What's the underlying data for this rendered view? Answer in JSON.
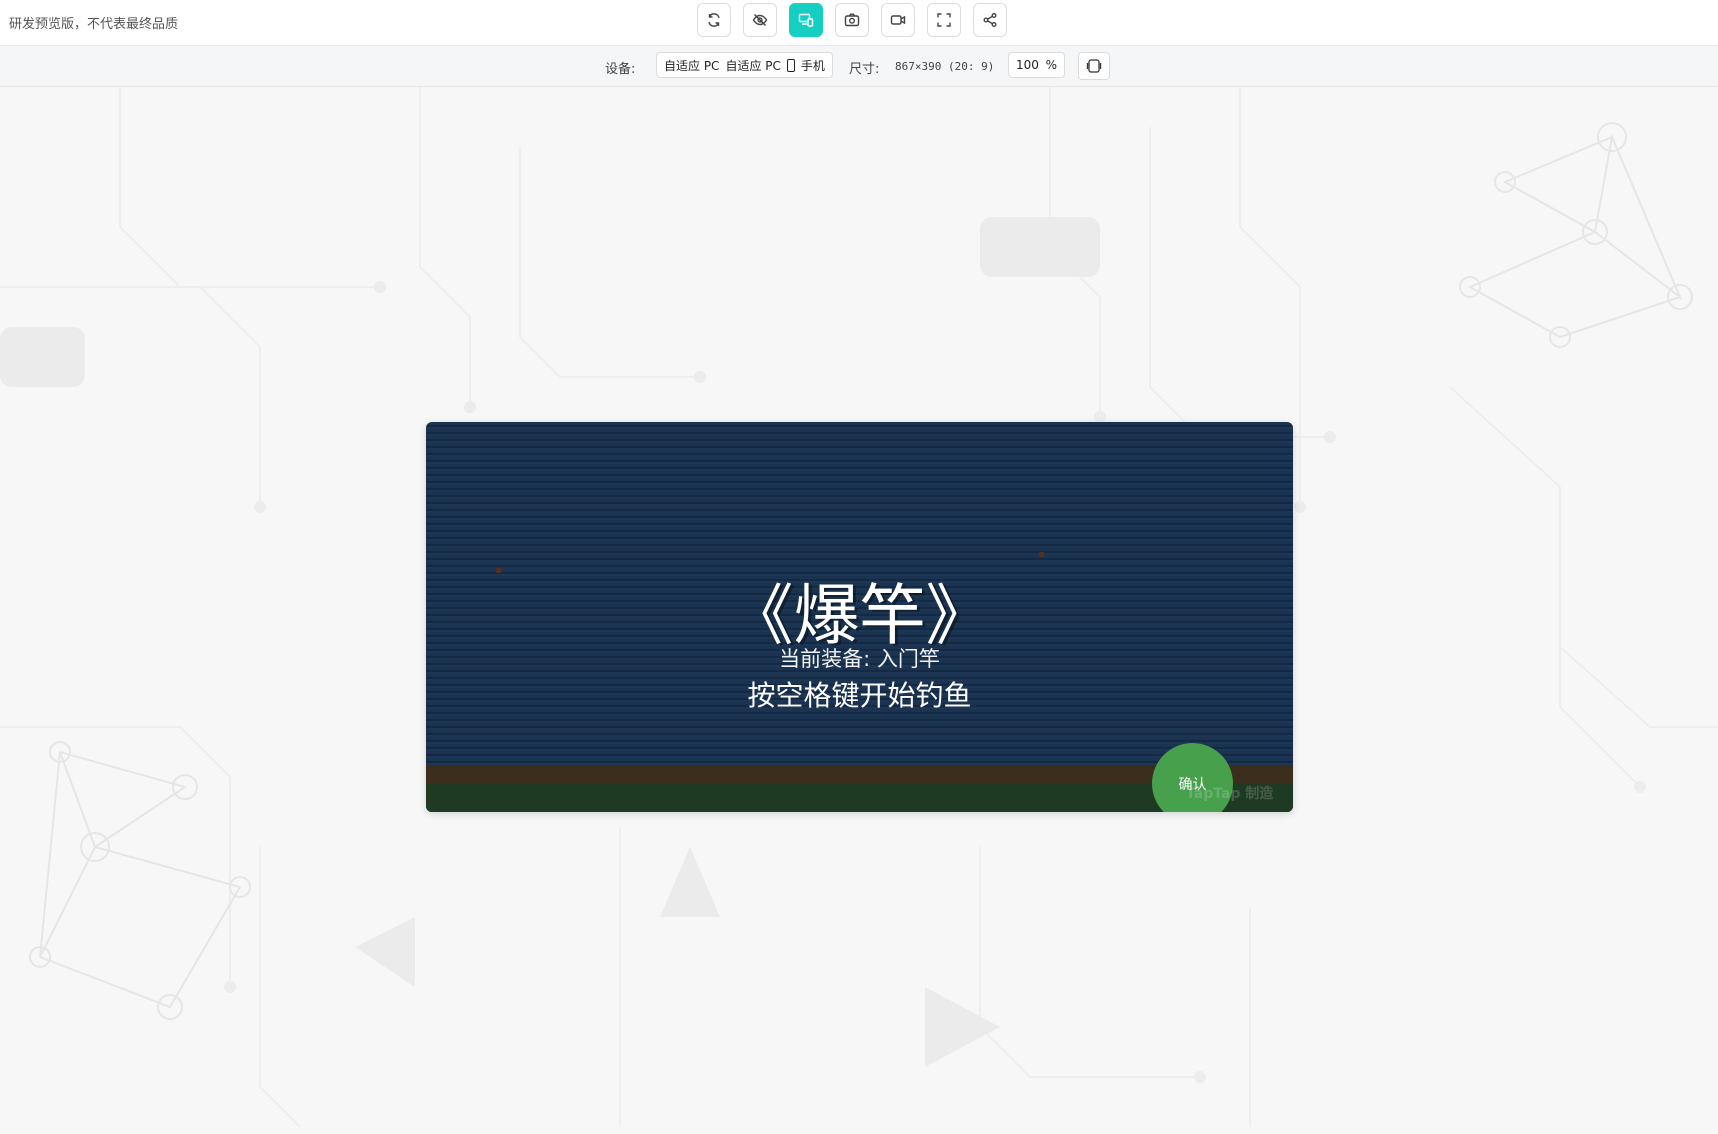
{
  "header": {
    "notice": "研发预览版，不代表最终品质",
    "tools": [
      {
        "name": "refresh-icon",
        "active": false
      },
      {
        "name": "eye-off-icon",
        "active": false
      },
      {
        "name": "device-switch-icon",
        "active": true
      },
      {
        "name": "camera-icon",
        "active": false
      },
      {
        "name": "video-icon",
        "active": false
      },
      {
        "name": "fullscreen-icon",
        "active": false
      },
      {
        "name": "share-icon",
        "active": false
      }
    ],
    "accent_color": "#15d0c2"
  },
  "subbar": {
    "device_label": "设备:",
    "device_options": [
      "自适应 PC",
      "自适应 PC",
      "手机"
    ],
    "size_label": "尺寸:",
    "size_value": "867×390 (20: 9)",
    "zoom_value": "100",
    "zoom_unit": "%"
  },
  "game": {
    "title": "《爆竿》",
    "equipment": "当前装备: 入门竿",
    "hint": "按空格键开始钓鱼",
    "confirm_label": "确认",
    "watermark": "TapTap 制造",
    "colors": {
      "water": "#1a3350",
      "dirt": "#3b2e1c",
      "grass": "#1e3a22",
      "button": "#46a04c"
    }
  }
}
